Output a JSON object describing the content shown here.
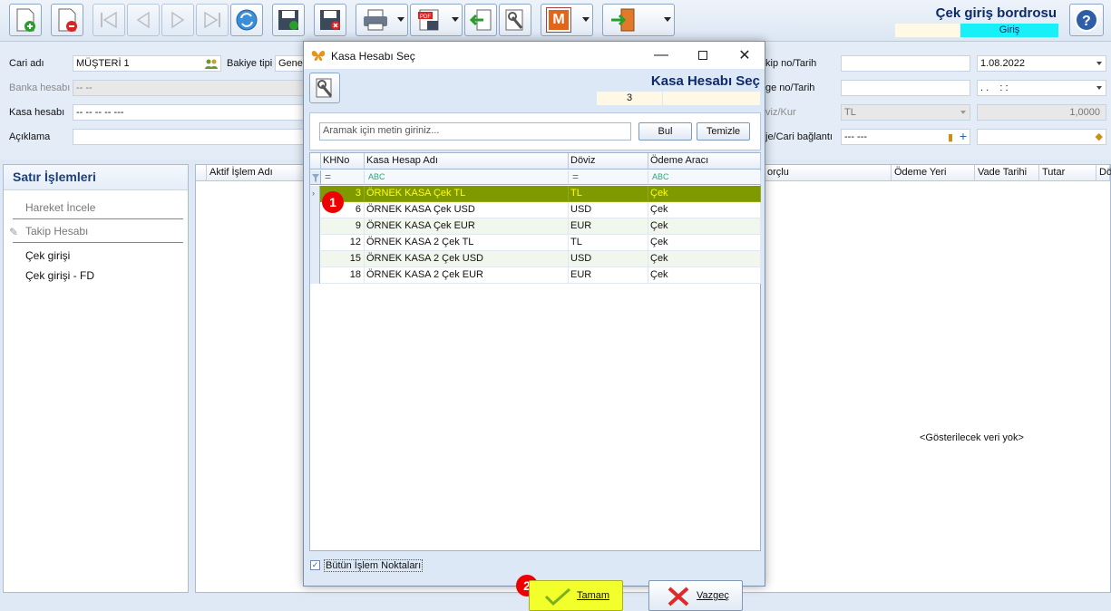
{
  "toolbar": {
    "title": "Çek giriş bordrosu",
    "mode": "Giriş",
    "m_label": "M"
  },
  "form": {
    "cari_adi_label": "Cari adı",
    "cari_adi_value": "MÜŞTERİ 1",
    "bakiye_tipi_label": "Bakiye tipi",
    "bakiye_tipi_value": "Genel",
    "banka_hesabi_label": "Banka hesabı",
    "banka_hesabi_value": "-- --",
    "kasa_hesabi_label": "Kasa hesabı",
    "kasa_hesabi_value": "-- -- -- -- ---",
    "aciklama_label": "Açıklama",
    "takip_label": "kip no/Tarih",
    "takip_date": "1.08.2022",
    "belge_label": "ge no/Tarih",
    "belge_date": ". .    : :",
    "doviz_label": "viz/Kur",
    "doviz_value": "TL",
    "kur_value": "1,0000",
    "proje_label": "je/Cari bağlantı",
    "proje_value": "--- ---"
  },
  "left_panel": {
    "title": "Satır İşlemleri",
    "items": [
      "Hareket İncele",
      "Takip Hesabı",
      "Çek girişi",
      "Çek girişi - FD"
    ]
  },
  "right_grid": {
    "columns": [
      "Aktif İşlem Adı",
      "orçlu",
      "Ödeme Yeri",
      "Vade Tarihi",
      "Tutar",
      "Dö"
    ],
    "empty_text": "<Gösterilecek veri yok>"
  },
  "dialog": {
    "window_title": "Kasa Hesabı Seç",
    "header_title": "Kasa Hesabı Seç",
    "header_value": "3",
    "search_placeholder": "Aramak için metin giriniz...",
    "bul_label": "Bul",
    "temizle_label": "Temizle",
    "columns": [
      "KHNo",
      "Kasa Hesap Adı",
      "Döviz",
      "Ödeme Aracı"
    ],
    "filter_text_glyph": "ABC",
    "filter_eq_glyph": "=",
    "rows": [
      {
        "no": "3",
        "name": "ÖRNEK KASA Çek TL",
        "doviz": "TL",
        "arac": "Çek"
      },
      {
        "no": "6",
        "name": "ÖRNEK KASA Çek USD",
        "doviz": "USD",
        "arac": "Çek"
      },
      {
        "no": "9",
        "name": "ÖRNEK KASA Çek EUR",
        "doviz": "EUR",
        "arac": "Çek"
      },
      {
        "no": "12",
        "name": "ÖRNEK KASA 2 Çek TL",
        "doviz": "TL",
        "arac": "Çek"
      },
      {
        "no": "15",
        "name": "ÖRNEK KASA 2 Çek USD",
        "doviz": "USD",
        "arac": "Çek"
      },
      {
        "no": "18",
        "name": "ÖRNEK KASA 2 Çek EUR",
        "doviz": "EUR",
        "arac": "Çek"
      }
    ],
    "checkbox_label": "Bütün İşlem Noktaları",
    "ok_label": "Tamam",
    "cancel_label": "Vazgeç",
    "badge1": "1",
    "badge2": "2"
  },
  "colors": {
    "selected_row_bg": "#7f9a00",
    "selected_row_text": "#ffff00",
    "title_color": "#0e2a6b",
    "mode_bg": "#18f0f8",
    "badge": "#ee0000"
  }
}
